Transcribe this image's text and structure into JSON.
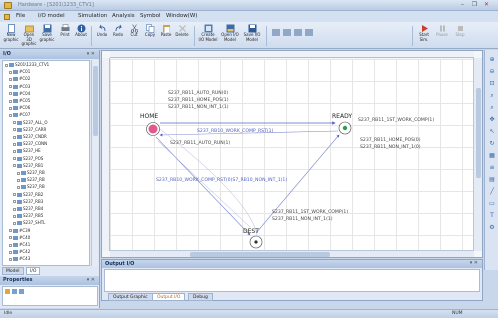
{
  "app": {
    "title": "Hardware - [S201\\1233_CTV1]",
    "win_min": "–",
    "win_max": "❐",
    "win_close": "✕"
  },
  "menu": [
    "File",
    "I/O model",
    "Simulation",
    "Analysis",
    "Symbol",
    "Window(W)"
  ],
  "ribbon": {
    "buttons": [
      {
        "label": "New\ngraphic",
        "icon": "new-graphic-icon"
      },
      {
        "label": "Open 3D\ngraphic",
        "icon": "open-3d-icon"
      },
      {
        "label": "Save\ngraphic",
        "icon": "save-icon"
      },
      {
        "label": "Print",
        "icon": "print-icon"
      },
      {
        "label": "About",
        "icon": "about-icon"
      },
      {
        "label": "Undo",
        "icon": "undo-icon"
      },
      {
        "label": "Redo",
        "icon": "redo-icon"
      },
      {
        "label": "Cut",
        "icon": "cut-icon"
      },
      {
        "label": "Copy",
        "icon": "copy-icon"
      },
      {
        "label": "Paste",
        "icon": "paste-icon"
      },
      {
        "label": "Delete",
        "icon": "delete-icon"
      },
      {
        "label": "Create\nI/O Model",
        "icon": "create-model-icon"
      },
      {
        "label": "Open I/O\nModel",
        "icon": "open-model-icon"
      },
      {
        "label": "Save I/O\nModel",
        "icon": "save-model-icon"
      },
      {
        "label": "Start\nSim.",
        "icon": "start-sim-icon"
      },
      {
        "label": "Pause",
        "icon": "pause-icon"
      },
      {
        "label": "Stop",
        "icon": "stop-icon"
      }
    ]
  },
  "left_pane": {
    "header": "I/O",
    "close": "▾ ✕",
    "tree": [
      "S201\\1233_CTV1",
      "#C01",
      "#C02",
      "#C03",
      "#C04",
      "#C05",
      "#C06",
      "#C07",
      "S237_ALL_O",
      "S237_CARR",
      "S237_CNDR",
      "S237_CONN",
      "S237_HE",
      "S237_POS",
      "S237_RB1",
      "S237_RB",
      "S237_RB",
      "S237_RB",
      "S237_RB2",
      "S237_RB3",
      "S237_RB4",
      "S237_RB5",
      "S237_SHTL",
      "#C39",
      "#C40",
      "#C41",
      "#C42",
      "#C43"
    ],
    "tabs": [
      "Model",
      "I/O"
    ],
    "properties_header": "Properties"
  },
  "diagram": {
    "states": {
      "home": "HOME",
      "ready": "READY",
      "dest": "DEST"
    },
    "labels": {
      "home_cond_1": "S237_RB11_AUTO_RUN(0)",
      "home_cond_2": "S237_RB11_HOME_POS(1)",
      "home_cond_3": "S237_RB11_NON_INT_1(1)",
      "to_ready": "S237_RB10_WORK_COMP_RST(1)",
      "back_auto": "S237_RB11_AUTO_RUN(1)",
      "ready_out": "S237_RB11_1ST_WORK_COMP(1)",
      "ready_home": "S237_RB11_HOME_POS(0)",
      "ready_nonint": "S237_RB11_NON_INT_1(0)",
      "to_dest": "S237_RB10_WORK_COMP_RST(0)S7_RB10_NON_INT_1(1)",
      "dest_1": "S237_RB11_1ST_WORK_COMP(1)",
      "dest_2": "S237_RB11_NON_INT_1(1)"
    }
  },
  "output": {
    "header": "Output I/O",
    "close": "▾ ✕",
    "tabs": [
      "Output Graphic",
      "Output I/O",
      "Debug"
    ],
    "active_tab": 1
  },
  "status": {
    "left": "Idle",
    "right": "NUM"
  }
}
